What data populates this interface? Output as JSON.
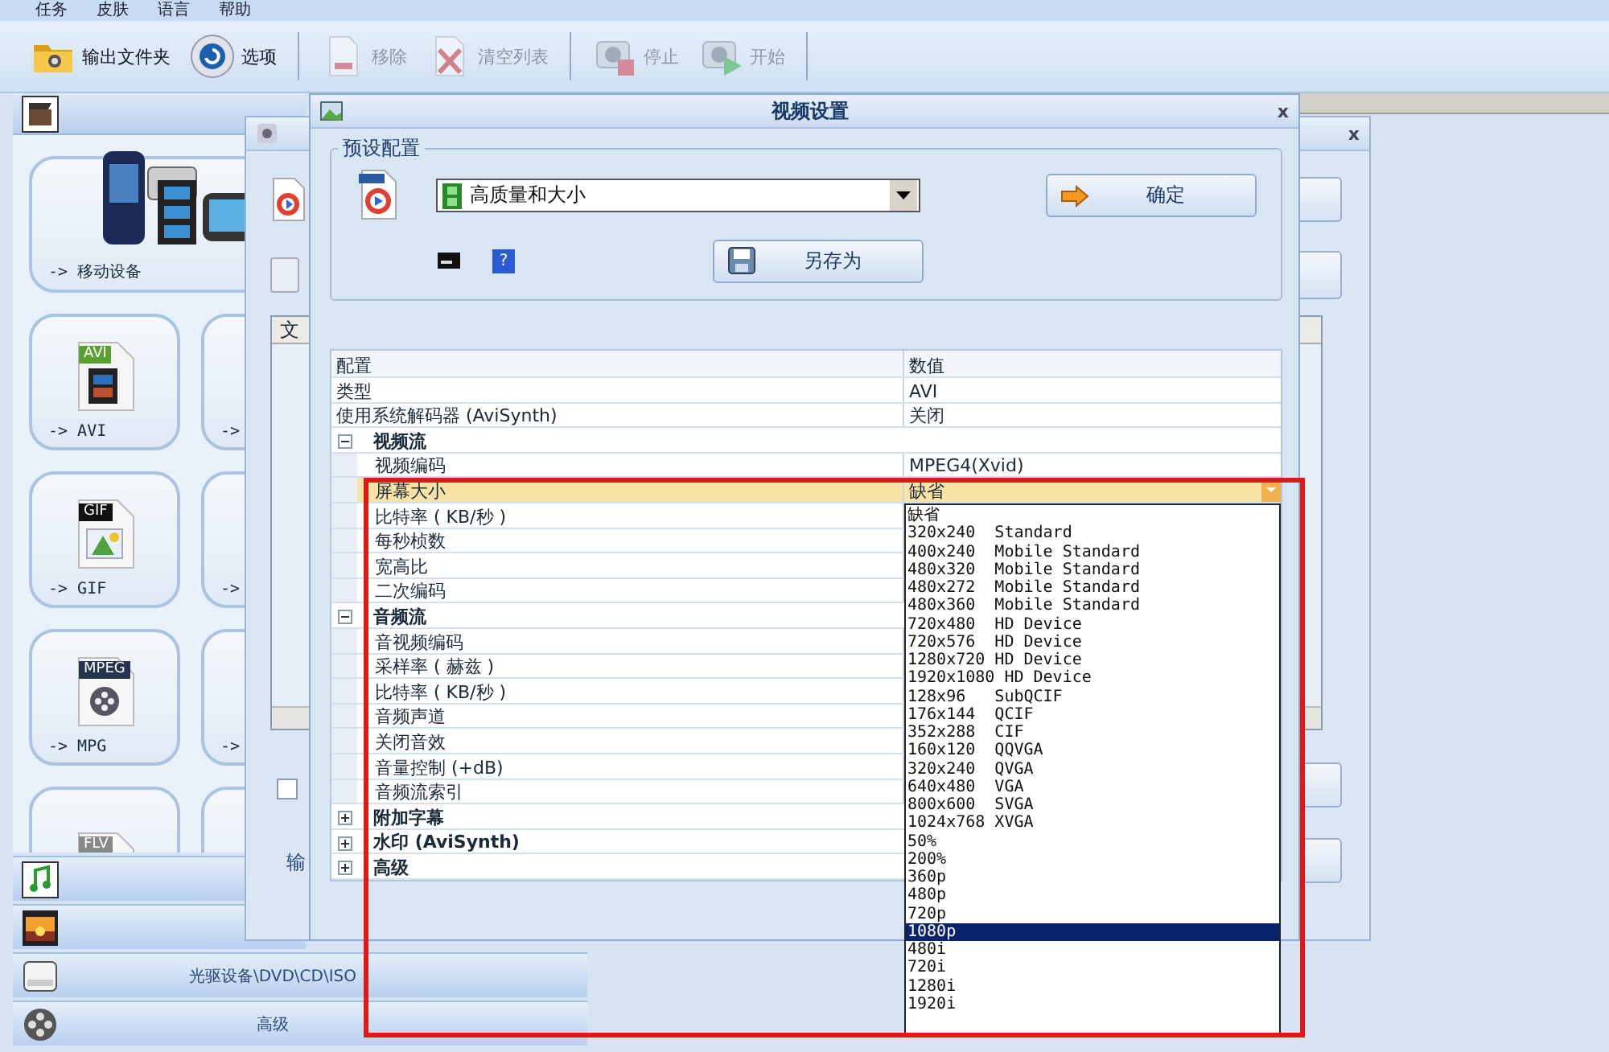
{
  "menu": [
    "任务",
    "皮肤",
    "语言",
    "帮助"
  ],
  "toolbar": [
    {
      "kind": "button",
      "label": "输出文件夹",
      "disabled": false
    },
    {
      "kind": "button",
      "label": "选项",
      "disabled": false
    },
    {
      "kind": "separator"
    },
    {
      "kind": "button",
      "label": "移除",
      "disabled": true
    },
    {
      "kind": "button",
      "label": "清空列表",
      "disabled": true
    },
    {
      "kind": "separator"
    },
    {
      "kind": "button",
      "label": "停止",
      "disabled": true
    },
    {
      "kind": "button",
      "label": "开始",
      "disabled": true
    },
    {
      "kind": "separator"
    }
  ],
  "sidebar": {
    "tiles": [
      {
        "kind": "wide",
        "label": "-> 移动设备"
      },
      {
        "kind": "file",
        "label": "-> AVI",
        "badge": "AVI"
      },
      {
        "kind": "blank",
        "label": "->"
      },
      {
        "kind": "file",
        "label": "-> GIF",
        "badge": "GIF"
      },
      {
        "kind": "blank",
        "label": "->"
      },
      {
        "kind": "file",
        "label": "-> MPG",
        "badge": "MPEG"
      },
      {
        "kind": "blank",
        "label": "->"
      },
      {
        "kind": "file",
        "badge": "FLV"
      },
      {
        "kind": "blank"
      }
    ],
    "categories": [
      {
        "kind": "bar"
      },
      {
        "kind": "bar"
      },
      {
        "kind": "bar",
        "label": "光驱设备\\DVD\\CD\\ISO"
      },
      {
        "kind": "bar",
        "label": "高级"
      }
    ]
  },
  "back_window": {
    "close": "x",
    "list_header": "文",
    "checkbox": {
      "checked": false
    },
    "label": "输"
  },
  "dialog": {
    "title": "视频设置",
    "close": "x",
    "preset": {
      "legend": "预设配置",
      "value": "高质量和大小",
      "ok": "确定",
      "help": "?",
      "save_as": "另存为"
    },
    "grid": {
      "columns": [
        "配置",
        "数值"
      ],
      "rows": [
        {
          "kind": "item",
          "label": "类型",
          "value": "AVI",
          "selected": false
        },
        {
          "kind": "item",
          "label": "使用系统解码器 (AviSynth)",
          "value": "关闭",
          "selected": false
        },
        {
          "kind": "group",
          "label": "视频流",
          "expanded": true,
          "selected": false,
          "children": [
            {
              "kind": "item",
              "label": "视频编码",
              "value": "MPEG4(Xvid)",
              "selected": false
            },
            {
              "kind": "item",
              "label": "屏幕大小",
              "value": "缺省",
              "selected": true
            },
            {
              "kind": "item",
              "label": "比特率 ( KB/秒 )",
              "selected": false
            },
            {
              "kind": "item",
              "label": "每秒桢数",
              "selected": false
            },
            {
              "kind": "item",
              "label": "宽高比",
              "selected": false
            },
            {
              "kind": "item",
              "label": "二次编码",
              "selected": false
            }
          ]
        },
        {
          "kind": "group",
          "label": "音频流",
          "expanded": true,
          "selected": false,
          "children": [
            {
              "kind": "item",
              "label": "音视频编码",
              "selected": false
            },
            {
              "kind": "item",
              "label": "采样率 ( 赫兹 )",
              "selected": false
            },
            {
              "kind": "item",
              "label": "比特率 ( KB/秒 )",
              "selected": false
            },
            {
              "kind": "item",
              "label": "音频声道",
              "selected": false
            },
            {
              "kind": "item",
              "label": "关闭音效",
              "selected": false
            },
            {
              "kind": "item",
              "label": "音量控制 (+dB)",
              "selected": false
            },
            {
              "kind": "item",
              "label": "音频流索引",
              "selected": false
            }
          ]
        },
        {
          "kind": "group",
          "label": "附加字幕",
          "expanded": false,
          "selected": false
        },
        {
          "kind": "group",
          "label": "水印 (AviSynth)",
          "expanded": false,
          "selected": false
        },
        {
          "kind": "group",
          "label": "高级",
          "expanded": false,
          "selected": false
        }
      ]
    },
    "dropdown": {
      "items": [
        {
          "label": "缺省",
          "selected": false
        },
        {
          "label": "320x240  Standard",
          "selected": false
        },
        {
          "label": "400x240  Mobile Standard",
          "selected": false
        },
        {
          "label": "480x320  Mobile Standard",
          "selected": false
        },
        {
          "label": "480x272  Mobile Standard",
          "selected": false
        },
        {
          "label": "480x360  Mobile Standard",
          "selected": false
        },
        {
          "label": "720x480  HD Device",
          "selected": false
        },
        {
          "label": "720x576  HD Device",
          "selected": false
        },
        {
          "label": "1280x720 HD Device",
          "selected": false
        },
        {
          "label": "1920x1080 HD Device",
          "selected": false
        },
        {
          "label": "128x96   SubQCIF",
          "selected": false
        },
        {
          "label": "176x144  QCIF",
          "selected": false
        },
        {
          "label": "352x288  CIF",
          "selected": false
        },
        {
          "label": "160x120  QQVGA",
          "selected": false
        },
        {
          "label": "320x240  QVGA",
          "selected": false
        },
        {
          "label": "640x480  VGA",
          "selected": false
        },
        {
          "label": "800x600  SVGA",
          "selected": false
        },
        {
          "label": "1024x768 XVGA",
          "selected": false
        },
        {
          "label": "50%",
          "selected": false
        },
        {
          "label": "200%",
          "selected": false
        },
        {
          "label": "360p",
          "selected": false
        },
        {
          "label": "480p",
          "selected": false
        },
        {
          "label": "720p",
          "selected": false
        },
        {
          "label": "1080p",
          "selected": true
        },
        {
          "label": "480i",
          "selected": false
        },
        {
          "label": "720i",
          "selected": false
        },
        {
          "label": "1280i",
          "selected": false
        },
        {
          "label": "1920i",
          "selected": false
        }
      ]
    }
  },
  "annotation": {
    "kind": "frame"
  }
}
